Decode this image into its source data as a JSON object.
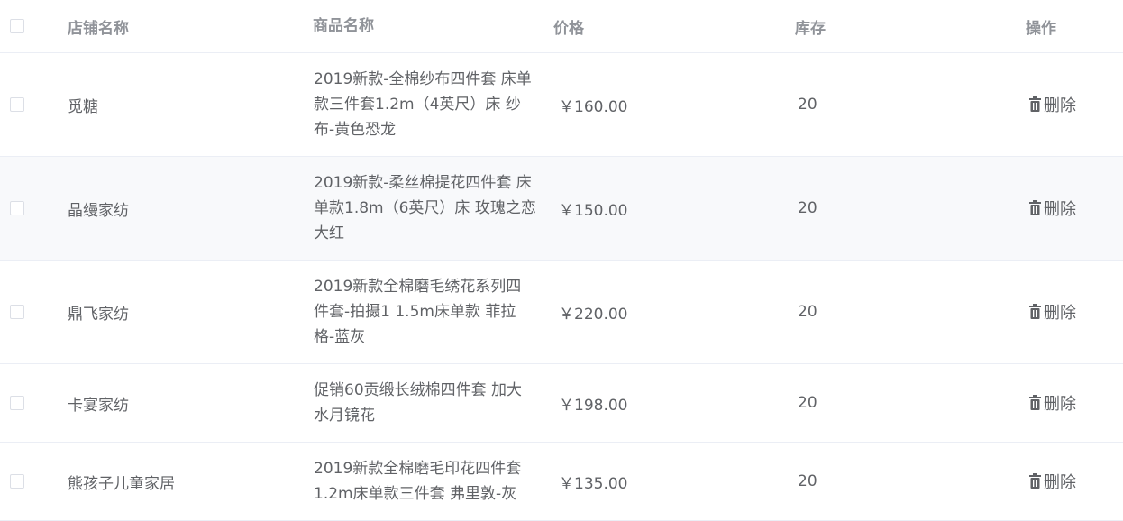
{
  "columns": {
    "shop": "店铺名称",
    "product": "商品名称",
    "price": "价格",
    "stock": "库存",
    "action": "操作"
  },
  "icons": {
    "delete": "trash-icon",
    "checkbox": "checkbox"
  },
  "rows": [
    {
      "shop": "觅糖",
      "product": "2019新款-全棉纱布四件套 床单款三件套1.2m（4英尺）床 纱布-黄色恐龙",
      "price": "￥160.00",
      "stock": "20",
      "action": "删除"
    },
    {
      "shop": "晶缦家纺",
      "product": "2019新款-柔丝棉提花四件套 床单款1.8m（6英尺）床 玫瑰之恋大红",
      "price": "￥150.00",
      "stock": "20",
      "action": "删除"
    },
    {
      "shop": "鼎飞家纺",
      "product": "2019新款全棉磨毛绣花系列四件套-拍摄1 1.5m床单款 菲拉格-蓝灰",
      "price": "￥220.00",
      "stock": "20",
      "action": "删除"
    },
    {
      "shop": "卡宴家纺",
      "product": "促销60贡缎长绒棉四件套 加大水月镜花",
      "price": "￥198.00",
      "stock": "20",
      "action": "删除"
    },
    {
      "shop": "熊孩子儿童家居",
      "product": "2019新款全棉磨毛印花四件套 1.2m床单款三件套 弗里敦-灰",
      "price": "￥135.00",
      "stock": "20",
      "action": "删除"
    }
  ]
}
